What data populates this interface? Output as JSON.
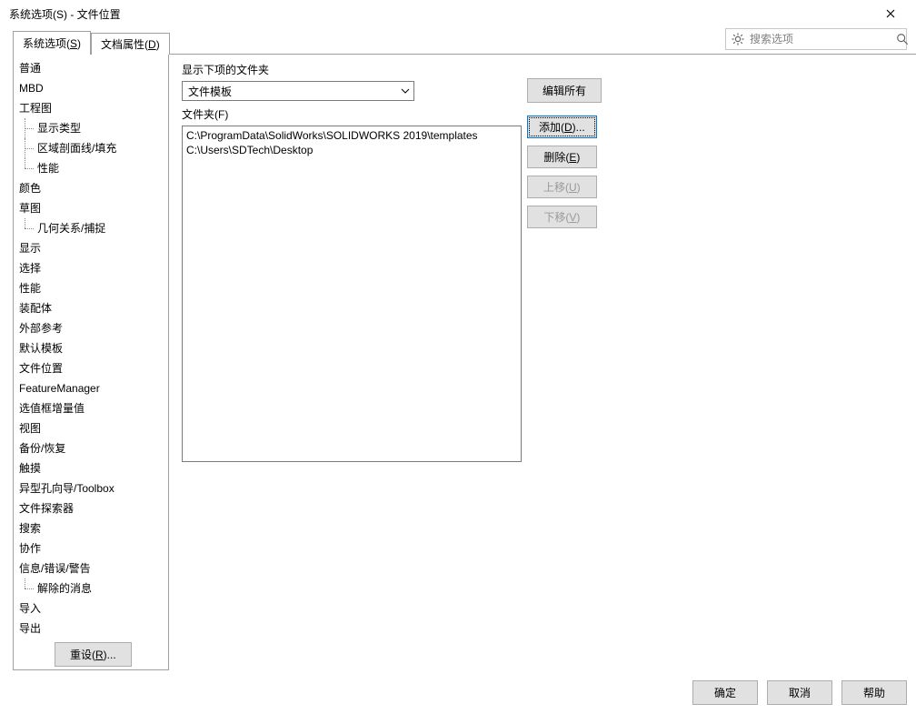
{
  "title": "系统选项(S) - 文件位置",
  "tabs": {
    "system_options": "系统选项(",
    "system_options_u": "S",
    "system_options_end": ")",
    "doc_props": "文档属性(",
    "doc_props_u": "D",
    "doc_props_end": ")"
  },
  "search_placeholder": "搜索选项",
  "sidebar": {
    "items": [
      {
        "label": "普通"
      },
      {
        "label": "MBD"
      },
      {
        "label": "工程图",
        "children": [
          "显示类型",
          "区域剖面线/填充",
          "性能"
        ]
      },
      {
        "label": "颜色"
      },
      {
        "label": "草图",
        "children": [
          "几何关系/捕捉"
        ]
      },
      {
        "label": "显示"
      },
      {
        "label": "选择"
      },
      {
        "label": "性能"
      },
      {
        "label": "装配体"
      },
      {
        "label": "外部参考"
      },
      {
        "label": "默认模板"
      },
      {
        "label": "文件位置"
      },
      {
        "label": "FeatureManager"
      },
      {
        "label": "选值框增量值"
      },
      {
        "label": "视图"
      },
      {
        "label": "备份/恢复"
      },
      {
        "label": "触摸"
      },
      {
        "label": "异型孔向导/Toolbox"
      },
      {
        "label": "文件探索器"
      },
      {
        "label": "搜索"
      },
      {
        "label": "协作"
      },
      {
        "label": "信息/错误/警告",
        "children": [
          "解除的消息"
        ]
      },
      {
        "label": "导入"
      },
      {
        "label": "导出"
      }
    ]
  },
  "main": {
    "show_folders_for": "显示下项的文件夹",
    "combo_value": "文件模板",
    "folders_label_pre": "文件夹(",
    "folders_label_u": "F",
    "folders_label_end": ")",
    "folders": [
      "C:\\ProgramData\\SolidWorks\\SOLIDWORKS 2019\\templates",
      "C:\\Users\\SDTech\\Desktop"
    ]
  },
  "buttons": {
    "edit_all": "编辑所有",
    "add_pre": "添加(",
    "add_u": "D",
    "add_end": ")...",
    "delete_pre": "删除(",
    "delete_u": "E",
    "delete_end": ")",
    "moveup_pre": "上移(",
    "moveup_u": "U",
    "moveup_end": ")",
    "movedown_pre": "下移(",
    "movedown_u": "V",
    "movedown_end": ")",
    "reset_pre": "重设(",
    "reset_u": "R",
    "reset_end": ")...",
    "ok": "确定",
    "cancel": "取消",
    "help": "帮助"
  }
}
